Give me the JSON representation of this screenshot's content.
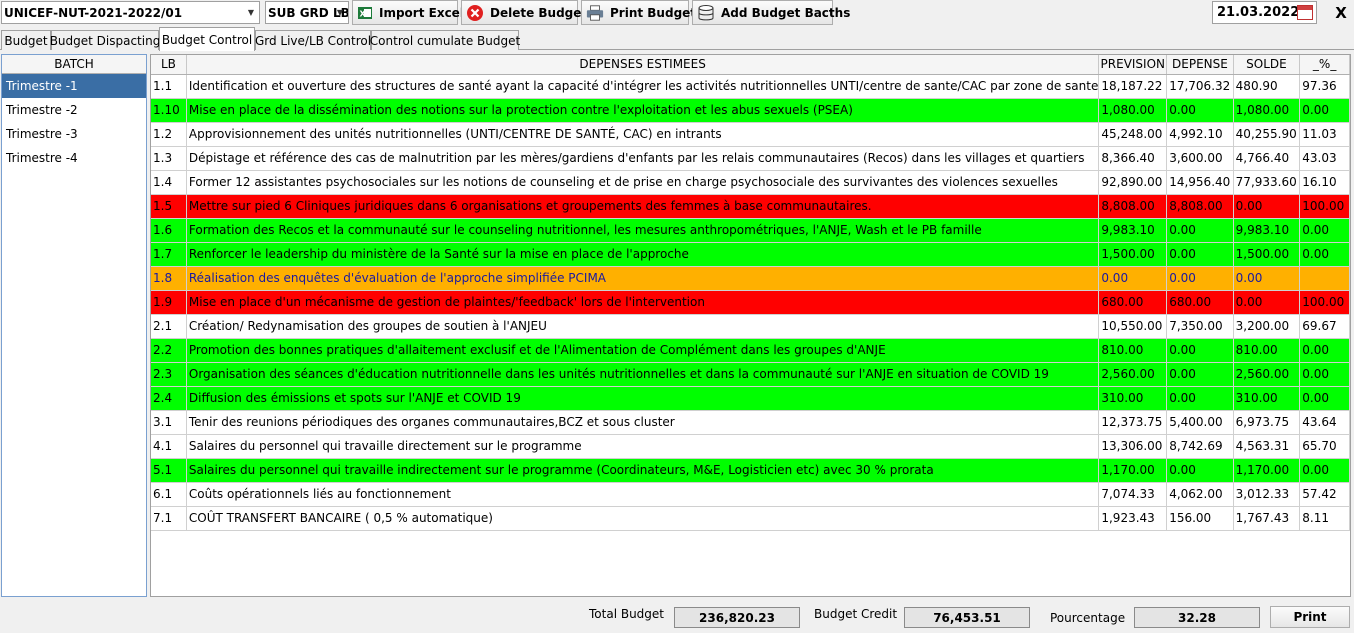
{
  "toolbar": {
    "project_select": "UNICEF-NUT-2021-2022/01",
    "sub_grd_select": "SUB GRD LB",
    "import_excel": "Import Excel",
    "delete_budget": "Delete Budget",
    "print_budget": "Print Budget",
    "add_budget_batchs": "Add Budget  Bacths",
    "date": "21.03.2022",
    "close": "X"
  },
  "tabs": [
    "Budget",
    "Budget Dispacting",
    "Budget Control",
    "Grd Live/LB Control",
    "Control cumulate Budget"
  ],
  "active_tab": "Budget Control",
  "batch": {
    "header": "BATCH",
    "items": [
      "Trimestre -1",
      "Trimestre -2",
      "Trimestre -3",
      "Trimestre -4"
    ],
    "selected": "Trimestre -1"
  },
  "grid": {
    "columns": [
      "LB",
      "DEPENSES ESTIMEES",
      "PREVISION",
      "DEPENSE",
      "SOLDE",
      "_%_"
    ],
    "row_colors": {
      "green": "#00ff00",
      "red": "#ff0000",
      "orange": "#ffb000",
      "white": "#ffffff"
    },
    "rows": [
      {
        "lb": "1.1",
        "desc": "Identification et ouverture des structures de santé ayant la capacité d'intégrer les activités nutritionnelles UNTI/centre de sante/CAC par zone de sante",
        "prev": "18,187.22",
        "dep": "17,706.32",
        "solde": "480.90",
        "pct": "97.36",
        "color": "white"
      },
      {
        "lb": "1.10",
        "desc": "Mise en place de la dissémination des notions sur la protection contre l'exploitation et les abus sexuels (PSEA)",
        "prev": "1,080.00",
        "dep": "0.00",
        "solde": "1,080.00",
        "pct": "0.00",
        "color": "green"
      },
      {
        "lb": "1.2",
        "desc": "Approvisionnement des unités nutritionnelles (UNTI/CENTRE DE SANTÉ, CAC) en intrants",
        "prev": "45,248.00",
        "dep": "4,992.10",
        "solde": "40,255.90",
        "pct": "11.03",
        "color": "white"
      },
      {
        "lb": "1.3",
        "desc": "Dépistage et référence des cas de malnutrition par les mères/gardiens d'enfants par les relais communautaires (Recos) dans les villages et quartiers",
        "prev": "8,366.40",
        "dep": "3,600.00",
        "solde": "4,766.40",
        "pct": "43.03",
        "color": "white"
      },
      {
        "lb": "1.4",
        "desc": "Former 12 assistantes psychosociales sur les notions de counseling et de prise en charge psychosociale des survivantes des violences sexuelles",
        "prev": "92,890.00",
        "dep": "14,956.40",
        "solde": "77,933.60",
        "pct": "16.10",
        "color": "white"
      },
      {
        "lb": "1.5",
        "desc": "Mettre sur pied 6 Cliniques juridiques dans 6 organisations et groupements des femmes à base communautaires.",
        "prev": "8,808.00",
        "dep": "8,808.00",
        "solde": "0.00",
        "pct": "100.00",
        "color": "red"
      },
      {
        "lb": "1.6",
        "desc": "Formation des Recos et la communauté sur le counseling nutritionnel, les mesures anthropométriques, l'ANJE, Wash et le PB famille",
        "prev": "9,983.10",
        "dep": "0.00",
        "solde": "9,983.10",
        "pct": "0.00",
        "color": "green"
      },
      {
        "lb": "1.7",
        "desc": "Renforcer le leadership du ministère de la Santé sur la mise en place de l'approche",
        "prev": "1,500.00",
        "dep": "0.00",
        "solde": "1,500.00",
        "pct": "0.00",
        "color": "green"
      },
      {
        "lb": "1.8",
        "desc": "Réalisation des enquêtes d'évaluation de l'approche simplifiée PCIMA",
        "prev": "0.00",
        "dep": "0.00",
        "solde": "0.00",
        "pct": "",
        "color": "orange"
      },
      {
        "lb": "1.9",
        "desc": "Mise en place d'un mécanisme de gestion de plaintes/'feedback' lors de l'intervention",
        "prev": "680.00",
        "dep": "680.00",
        "solde": "0.00",
        "pct": "100.00",
        "color": "red"
      },
      {
        "lb": "2.1",
        "desc": "Création/ Redynamisation des groupes de soutien à l'ANJEU",
        "prev": "10,550.00",
        "dep": "7,350.00",
        "solde": "3,200.00",
        "pct": "69.67",
        "color": "white"
      },
      {
        "lb": "2.2",
        "desc": "Promotion des bonnes pratiques d'allaitement exclusif et de l'Alimentation de Complément dans les groupes d'ANJE",
        "prev": "810.00",
        "dep": "0.00",
        "solde": "810.00",
        "pct": "0.00",
        "color": "green"
      },
      {
        "lb": "2.3",
        "desc": "Organisation des séances d'éducation nutritionnelle dans les unités nutritionnelles et dans la communauté sur l'ANJE en situation de COVID 19",
        "prev": "2,560.00",
        "dep": "0.00",
        "solde": "2,560.00",
        "pct": "0.00",
        "color": "green"
      },
      {
        "lb": "2.4",
        "desc": "Diffusion des émissions et spots sur l'ANJE et COVID 19",
        "prev": "310.00",
        "dep": "0.00",
        "solde": "310.00",
        "pct": "0.00",
        "color": "green"
      },
      {
        "lb": "3.1",
        "desc": "Tenir des reunions périodiques des organes communautaires,BCZ et sous cluster",
        "prev": "12,373.75",
        "dep": "5,400.00",
        "solde": "6,973.75",
        "pct": "43.64",
        "color": "white"
      },
      {
        "lb": "4.1",
        "desc": "Salaires du personnel qui travaille directement sur le programme",
        "prev": "13,306.00",
        "dep": "8,742.69",
        "solde": "4,563.31",
        "pct": "65.70",
        "color": "white"
      },
      {
        "lb": "5.1",
        "desc": "Salaires du personnel qui travaille indirectement sur le programme (Coordinateurs, M&E, Logisticien etc) avec 30 % prorata",
        "prev": "1,170.00",
        "dep": "0.00",
        "solde": "1,170.00",
        "pct": "0.00",
        "color": "green"
      },
      {
        "lb": "6.1",
        "desc": "Coûts opérationnels liés au fonctionnement",
        "prev": "7,074.33",
        "dep": "4,062.00",
        "solde": "3,012.33",
        "pct": "57.42",
        "color": "white"
      },
      {
        "lb": "7.1",
        "desc": "COÛT TRANSFERT BANCAIRE ( 0,5 % automatique)",
        "prev": "1,923.43",
        "dep": "156.00",
        "solde": "1,767.43",
        "pct": "8.11",
        "color": "white"
      }
    ]
  },
  "footer": {
    "total_budget_label": "Total Budget",
    "total_budget_value": "236,820.23",
    "budget_credit_label": "Budget Credit",
    "budget_credit_value": "76,453.51",
    "pourcentage_label": "Pourcentage",
    "pourcentage_value": "32.28",
    "print_label": "Print"
  }
}
